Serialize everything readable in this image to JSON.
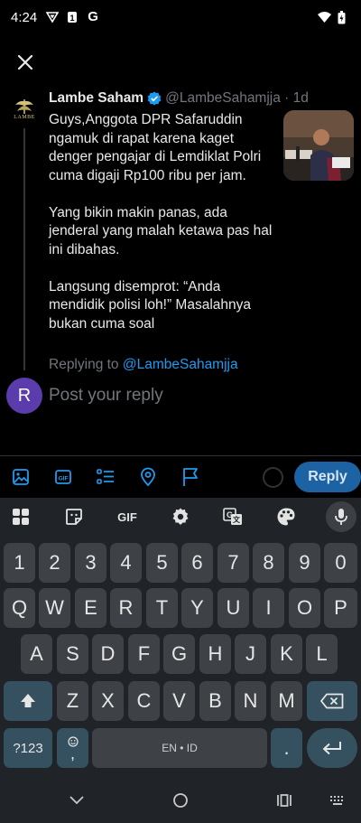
{
  "status_bar": {
    "time": "4:24",
    "left_icons": [
      "vpn-icon",
      "notification-icon",
      "google-icon"
    ],
    "right_icons": [
      "wifi-icon",
      "battery-icon"
    ],
    "google_glyph": "G"
  },
  "top_bar": {
    "close_icon": "close-icon"
  },
  "tweet": {
    "author_name": "Lambe Saham",
    "verified": true,
    "handle_meta": "@LambeSahamjja · 1d",
    "avatar_logo_text": "LAMBE",
    "paragraphs": [
      "Guys,Anggota DPR Safaruddin ngamuk di rapat karena kaget denger pengajar di Lemdiklat Polri cuma digaji Rp100 ribu per jam.",
      "Yang bikin makin panas, ada jenderal yang malah ketawa pas hal ini dibahas.",
      "Langsung disemprot: “Anda mendidik polisi loh!” Masalahnya bukan cuma soal"
    ]
  },
  "reply": {
    "replying_to_label": "Replying to",
    "replying_to_handle": "@LambeSahamjja",
    "user_avatar_letter": "R",
    "placeholder": "Post your reply",
    "button_label": "Reply"
  },
  "compose_toolbar": {
    "icons": [
      "image-icon",
      "gif-icon",
      "poll-icon",
      "location-icon",
      "flag-icon"
    ],
    "gif_label": "GIF",
    "accent_color": "#1d9bf0"
  },
  "keyboard": {
    "toolbar": {
      "gif_label": "GIF",
      "icons": [
        "apps-grid-icon",
        "sticker-icon",
        "gif-icon",
        "settings-icon",
        "translate-icon",
        "palette-icon",
        "mic-icon"
      ]
    },
    "number_row": [
      "1",
      "2",
      "3",
      "4",
      "5",
      "6",
      "7",
      "8",
      "9",
      "0"
    ],
    "row1": [
      "Q",
      "W",
      "E",
      "R",
      "T",
      "Y",
      "U",
      "I",
      "O",
      "P"
    ],
    "row2": [
      "A",
      "S",
      "D",
      "F",
      "G",
      "H",
      "J",
      "K",
      "L"
    ],
    "row3": [
      "Z",
      "X",
      "C",
      "V",
      "B",
      "N",
      "M"
    ],
    "symbols_label": "?123",
    "comma_label": ",",
    "space_label": "EN • ID",
    "period_label": "."
  },
  "nav_bar": {
    "icons": [
      "back-icon",
      "home-icon",
      "recents-icon",
      "keyboard-switch-icon"
    ]
  }
}
